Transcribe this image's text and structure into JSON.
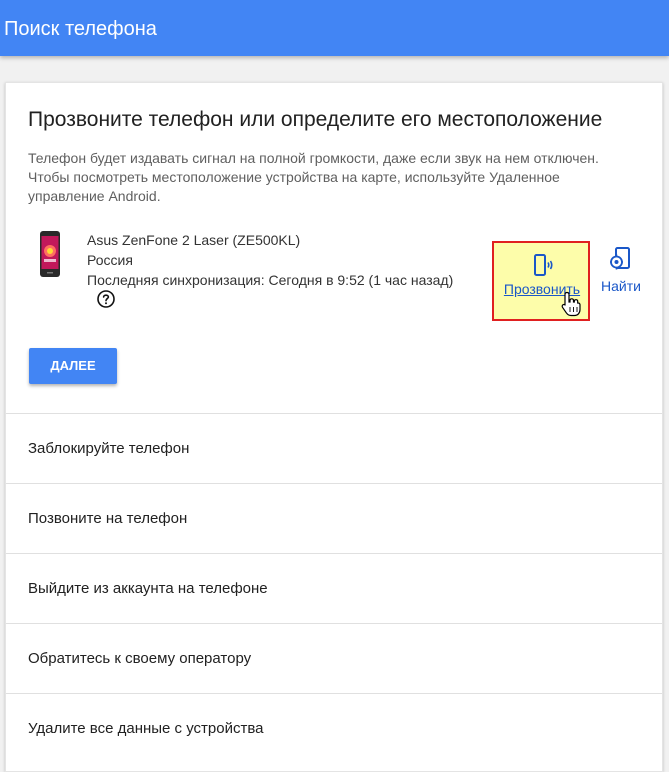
{
  "header": {
    "title": "Поиск телефона",
    "color": "#4285f4"
  },
  "card": {
    "heading": "Прозвоните телефон или определите его местоположение",
    "description": "Телефон будет издавать сигнал на полной громкости, даже если звук на нем отключен. Чтобы посмотреть местоположение устройства на карте, используйте Удаленное управление Android."
  },
  "device": {
    "name": "Asus ZenFone 2 Laser (ZE500KL)",
    "country": "Россия",
    "sync": "Последняя синхронизация: Сегодня в 9:52 (1 час назад)",
    "image_icon": "smartphone-image",
    "help_icon": "help-circle-icon"
  },
  "actions": {
    "ring_label": "Прозвонить",
    "ring_icon": "phone-ringing-icon",
    "find_label": "Найти",
    "find_icon": "phone-locate-icon",
    "highlight_color": "#fdfdaa",
    "highlight_border": "#e02020",
    "link_color": "#1a57c8"
  },
  "next_button": {
    "label": "ДАЛЕЕ"
  },
  "options": [
    "Заблокируйте телефон",
    "Позвоните на телефон",
    "Выйдите из аккаунта на телефоне",
    "Обратитесь к своему оператору",
    "Удалите все данные с устройства"
  ]
}
